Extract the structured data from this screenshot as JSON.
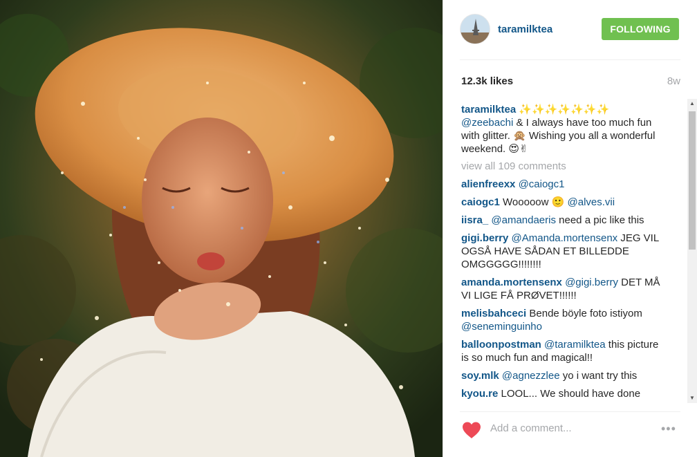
{
  "photo": {
    "alt": "girl in straw hat blowing glitter"
  },
  "header": {
    "username": "taramilktea",
    "follow_label": "FOLLOWING"
  },
  "stats": {
    "likes": "12.3k likes",
    "age": "8w"
  },
  "caption": {
    "user": "taramilktea",
    "sparkles": "✨✨✨✨✨✨✨",
    "mention": "@zeebachi",
    "text_1": " & I always have too much fun with glitter. ",
    "emoji_1": "🙊",
    "text_2": " Wishing you all a wonderful weekend. ",
    "emoji_2": "😍✌"
  },
  "view_all": "view all 109 comments",
  "comments": [
    {
      "user": "alienfreexx",
      "mention": "@caiogc1",
      "text": ""
    },
    {
      "user": "caiogc1",
      "pre": "Wooooow 🙂 ",
      "mention": "@alves.vii",
      "text": ""
    },
    {
      "user": "iisra_",
      "mention": "@amandaeris",
      "text": " need a pic like this"
    },
    {
      "user": "gigi.berry",
      "mention": "@Amanda.mortensenx",
      "text": " JEG VIL OGSÅ HAVE SÅDAN ET BILLEDDE OMGGGGG!!!!!!!!"
    },
    {
      "user": "amanda.mortensenx",
      "mention": "@gigi.berry",
      "text": " DET MÅ VI LIGE FÅ PRØVET!!!!!!"
    },
    {
      "user": "melisbahceci",
      "pre": "Bende böyle foto istiyom ",
      "mention": "@seneminguinho",
      "text": ""
    },
    {
      "user": "balloonpostman",
      "mention": "@taramilktea",
      "text": " this picture is so much fun and magical!!"
    },
    {
      "user": "soy.mlk",
      "mention": "@agnezzlee",
      "text": " yo i want try this"
    },
    {
      "user": "kyou.re",
      "pre": "LOOL... We should have done",
      "mention": "",
      "text": ""
    }
  ],
  "footer": {
    "placeholder": "Add a comment...",
    "more_label": "•••"
  },
  "colors": {
    "username_blue": "#125688",
    "follow_green": "#70c050",
    "heart_red": "#ed4956",
    "muted_gray": "#a5a7aa"
  },
  "icons": {
    "heart": "heart-icon",
    "more": "more-options-icon",
    "scroll_up": "scroll-up-arrow-icon",
    "scroll_down": "scroll-down-arrow-icon"
  }
}
